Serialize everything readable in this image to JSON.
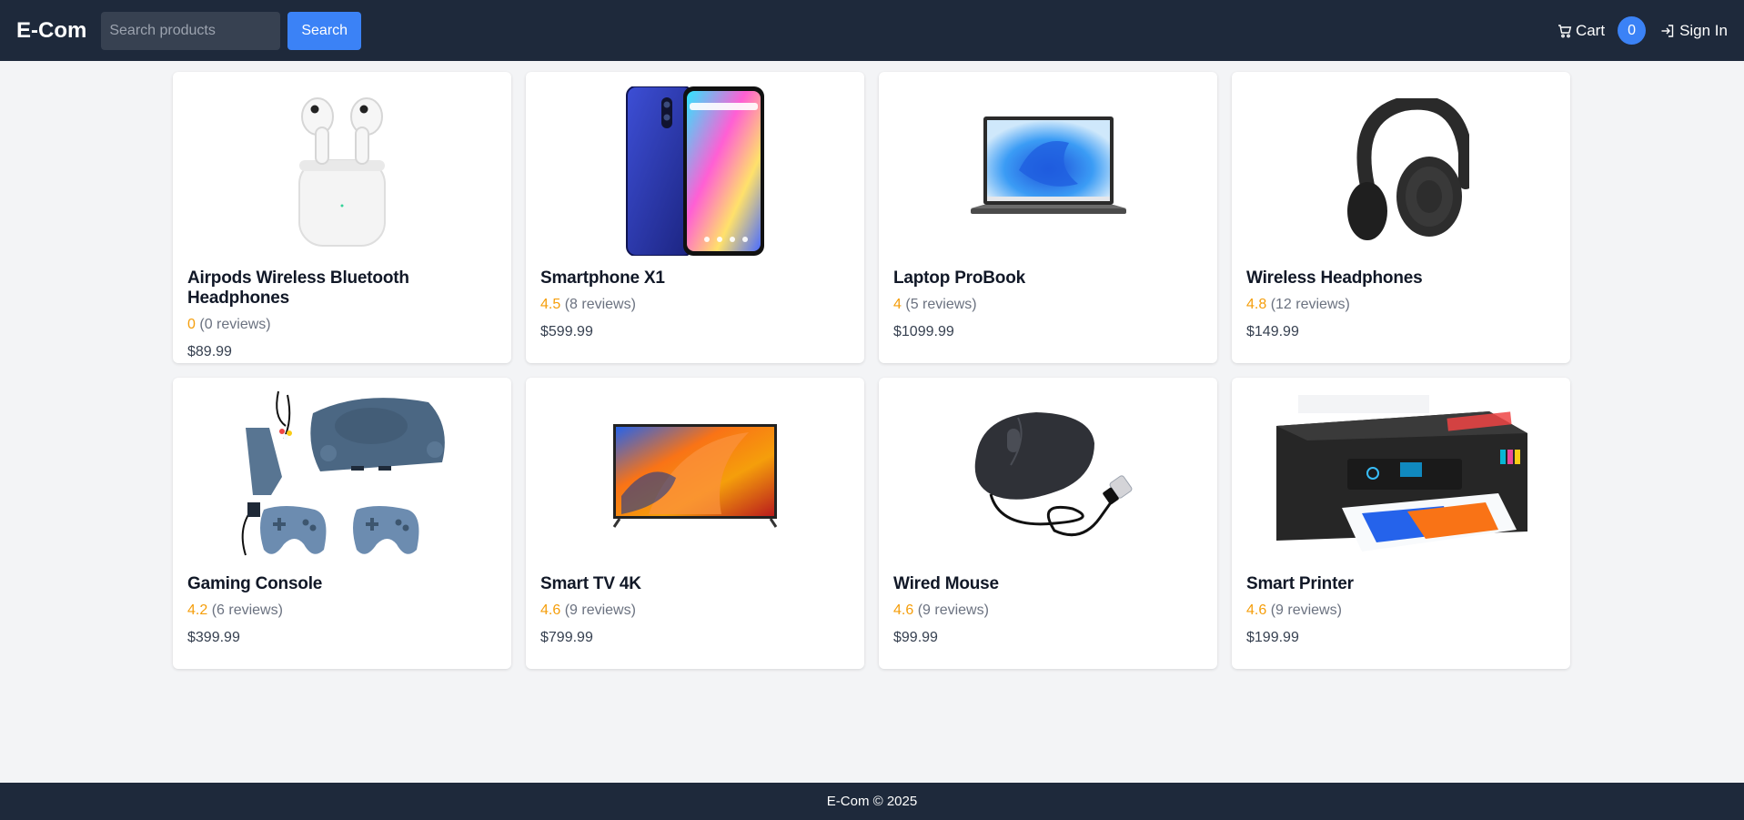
{
  "nav": {
    "brand": "E-Com",
    "search_placeholder": "Search products",
    "search_button": "Search",
    "cart_label": "Cart",
    "cart_count": "0",
    "signin_label": "Sign In"
  },
  "products": [
    {
      "title": "Airpods Wireless Bluetooth Headphones",
      "rating": "0",
      "reviews": "(0 reviews)",
      "price": "$89.99",
      "image": "airpods"
    },
    {
      "title": "Smartphone X1",
      "rating": "4.5",
      "reviews": "(8 reviews)",
      "price": "$599.99",
      "image": "smartphone"
    },
    {
      "title": "Laptop ProBook",
      "rating": "4",
      "reviews": "(5 reviews)",
      "price": "$1099.99",
      "image": "laptop"
    },
    {
      "title": "Wireless Headphones",
      "rating": "4.8",
      "reviews": "(12 reviews)",
      "price": "$149.99",
      "image": "headphones"
    },
    {
      "title": "Gaming Console",
      "rating": "4.2",
      "reviews": "(6 reviews)",
      "price": "$399.99",
      "image": "console"
    },
    {
      "title": "Smart TV 4K",
      "rating": "4.6",
      "reviews": "(9 reviews)",
      "price": "$799.99",
      "image": "tv"
    },
    {
      "title": "Wired Mouse",
      "rating": "4.6",
      "reviews": "(9 reviews)",
      "price": "$99.99",
      "image": "mouse"
    },
    {
      "title": "Smart Printer",
      "rating": "4.6",
      "reviews": "(9 reviews)",
      "price": "$199.99",
      "image": "printer"
    }
  ],
  "footer": {
    "text": "E-Com © 2025"
  },
  "colors": {
    "navbar": "#1e293b",
    "accent": "#3b82f6",
    "rating": "#f59e0b",
    "background": "#f3f4f6"
  }
}
